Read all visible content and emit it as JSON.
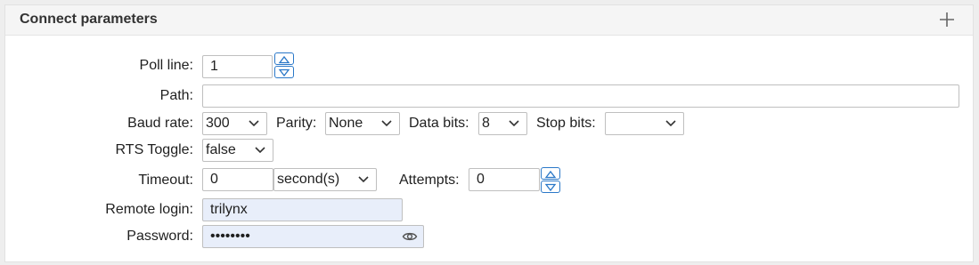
{
  "section": {
    "title": "Connect parameters"
  },
  "poll_line": {
    "label": "Poll line:",
    "value": "1"
  },
  "path": {
    "label": "Path:",
    "value": ""
  },
  "baud_rate": {
    "label": "Baud rate:",
    "value": "300"
  },
  "parity": {
    "label": "Parity:",
    "value": "None"
  },
  "data_bits": {
    "label": "Data bits:",
    "value": "8"
  },
  "stop_bits": {
    "label": "Stop bits:",
    "value": ""
  },
  "rts_toggle": {
    "label": "RTS Toggle:",
    "value": "false"
  },
  "timeout": {
    "label": "Timeout:",
    "value": "0",
    "unit": "second(s)"
  },
  "attempts": {
    "label": "Attempts:",
    "value": "0"
  },
  "remote_login": {
    "label": "Remote login:",
    "value": "trilynx"
  },
  "password": {
    "label": "Password:",
    "value": "••••••••"
  },
  "colors": {
    "accent": "#2a78c8",
    "autofill_bg": "#e8eefa",
    "header_bg": "#f5f5f5"
  }
}
